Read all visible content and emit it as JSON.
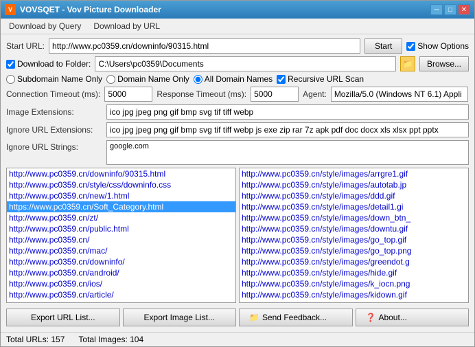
{
  "window": {
    "title": "VOVSQET - Vov Picture Downloader",
    "icon": "V"
  },
  "menu": {
    "items": [
      "Download by Query",
      "Download by URL"
    ]
  },
  "toolbar": {
    "start_url_label": "Start URL:",
    "start_url_value": "http://www.pc0359.cn/downinfo/90315.html",
    "start_button": "Start",
    "show_options_label": "Show Options"
  },
  "options": {
    "download_to_folder_label": "Download to Folder:",
    "folder_path": "C:\\Users\\pc0359\\Documents",
    "browse_button": "Browse...",
    "subdomain_only_label": "Subdomain Name Only",
    "domain_only_label": "Domain Name Only",
    "all_domains_label": "All Domain Names",
    "recursive_scan_label": "Recursive URL Scan",
    "connection_timeout_label": "Connection Timeout (ms):",
    "connection_timeout_value": "5000",
    "response_timeout_label": "Response Timeout (ms):",
    "response_timeout_value": "5000",
    "agent_label": "Agent:",
    "agent_value": "Mozilla/5.0 (Windows NT 6.1) Appli",
    "image_extensions_label": "Image Extensions:",
    "image_extensions_value": "ico jpg jpeg png gif bmp svg tif tiff webp",
    "ignore_url_label": "Ignore URL Extensions:",
    "ignore_url_value": "ico jpg jpeg png gif bmp svg tif tiff webp js exe zip rar 7z apk pdf doc docx xls xlsx ppt pptx",
    "ignore_strings_label": "Ignore URL Strings:",
    "ignore_strings_value": "google.com"
  },
  "url_list": {
    "items": [
      "http://www.pc0359.cn/downinfo/90315.html",
      "http://www.pc0359.cn/style/css/downinfo.css",
      "http://www.pc0359.cn/new/1.html",
      "https://www.pc0359.cn/Soft_Category.html",
      "http://www.pc0359.cn/zt/",
      "http://www.pc0359.cn/public.html",
      "http://www.pc0359.cn/",
      "http://www.pc0359.cn/mac/",
      "http://www.pc0359.cn/downinfo/",
      "http://www.pc0359.cn/android/",
      "http://www.pc0359.cn/ios/",
      "http://www.pc0359.cn/article/"
    ]
  },
  "image_list": {
    "items": [
      "http://www.pc0359.cn/style/images/arrgre1.gif",
      "http://www.pc0359.cn/style/images/autotab.jp",
      "http://www.pc0359.cn/style/images/ddd.gif",
      "http://www.pc0359.cn/style/images/detail1.gi",
      "http://www.pc0359.cn/style/images/down_btn_",
      "http://www.pc0359.cn/style/images/downtu.gif",
      "http://www.pc0359.cn/style/images/go_top.gif",
      "http://www.pc0359.cn/style/images/go_top.png",
      "http://www.pc0359.cn/style/images/greendot.g",
      "http://www.pc0359.cn/style/images/hide.gif",
      "http://www.pc0359.cn/style/images/k_iocn.png",
      "http://www.pc0359.cn/style/images/kidown.gif"
    ]
  },
  "buttons": {
    "export_url": "Export URL List...",
    "export_image": "Export Image List...",
    "send_feedback": "Send Feedback...",
    "about": "About..."
  },
  "status": {
    "total_urls_label": "Total URLs:",
    "total_urls_value": "157",
    "total_images_label": "Total Images:",
    "total_images_value": "104"
  }
}
